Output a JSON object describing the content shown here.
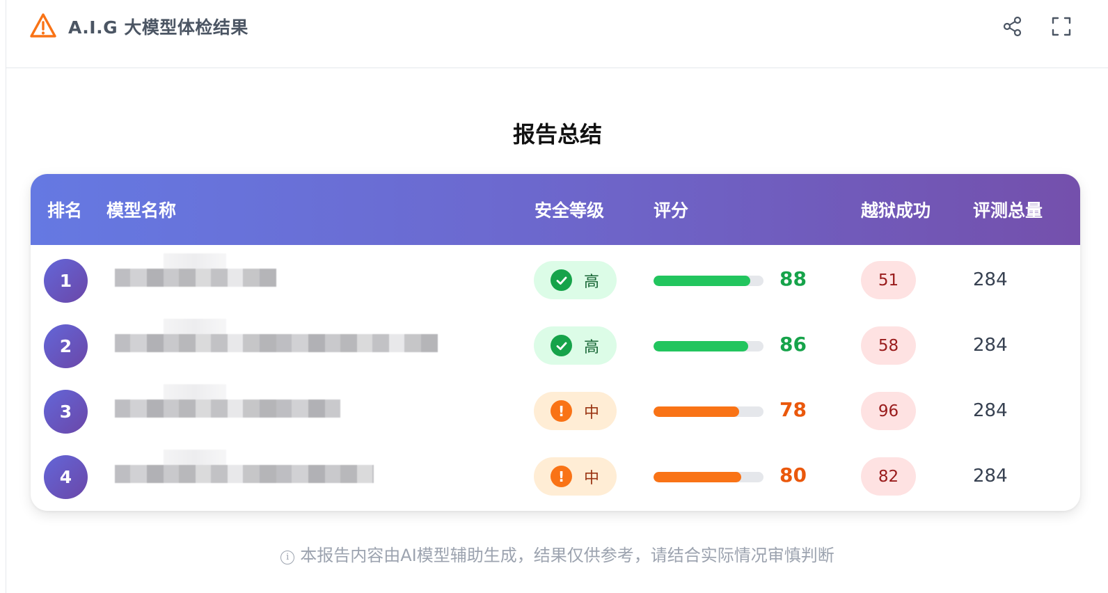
{
  "header": {
    "title": "A.I.G 大模型体检结果",
    "icons": {
      "left": "warning-triangle-icon",
      "share": "share-icon",
      "fullscreen": "fullscreen-icon"
    },
    "accent_color": "#f97316"
  },
  "report": {
    "title": "报告总结",
    "columns": [
      "排名",
      "模型名称",
      "安全等级",
      "评分",
      "越狱成功",
      "评测总量"
    ],
    "rows": [
      {
        "rank": "1",
        "level": "高",
        "level_type": "high",
        "score": "88",
        "score_fraction": 0.88,
        "jailbreak": "51",
        "total": "284"
      },
      {
        "rank": "2",
        "level": "高",
        "level_type": "high",
        "score": "86",
        "score_fraction": 0.86,
        "jailbreak": "58",
        "total": "284"
      },
      {
        "rank": "3",
        "level": "中",
        "level_type": "mid",
        "score": "78",
        "score_fraction": 0.78,
        "jailbreak": "96",
        "total": "284"
      },
      {
        "rank": "4",
        "level": "中",
        "level_type": "mid",
        "score": "80",
        "score_fraction": 0.8,
        "jailbreak": "82",
        "total": "284"
      }
    ],
    "colors": {
      "header_gradient_start": "#6579e2",
      "header_gradient_end": "#7450ac",
      "high": "#22c55e",
      "mid": "#f97316",
      "jailbreak_bg": "#fee2e2"
    }
  },
  "footer": {
    "note": "本报告内容由AI模型辅助生成，结果仅供参考，请结合实际情况审慎判断",
    "icon": "info-icon"
  }
}
